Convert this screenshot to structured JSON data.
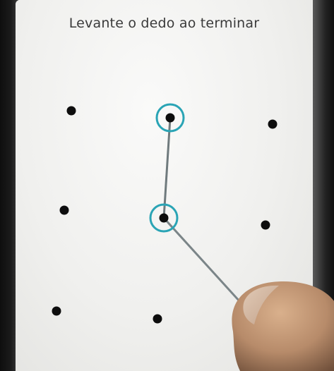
{
  "lock_screen": {
    "instruction": "Levante o dedo ao terminar"
  },
  "pattern": {
    "dots": [
      {
        "row": 1,
        "col": 1,
        "selected": false
      },
      {
        "row": 1,
        "col": 2,
        "selected": true
      },
      {
        "row": 1,
        "col": 3,
        "selected": false
      },
      {
        "row": 2,
        "col": 1,
        "selected": false
      },
      {
        "row": 2,
        "col": 2,
        "selected": true
      },
      {
        "row": 2,
        "col": 3,
        "selected": false
      },
      {
        "row": 3,
        "col": 1,
        "selected": false
      },
      {
        "row": 3,
        "col": 2,
        "selected": false
      },
      {
        "row": 3,
        "col": 3,
        "selected": false
      }
    ],
    "selected_sequence": [
      2,
      5
    ],
    "accent_color": "#2aa4b5"
  }
}
